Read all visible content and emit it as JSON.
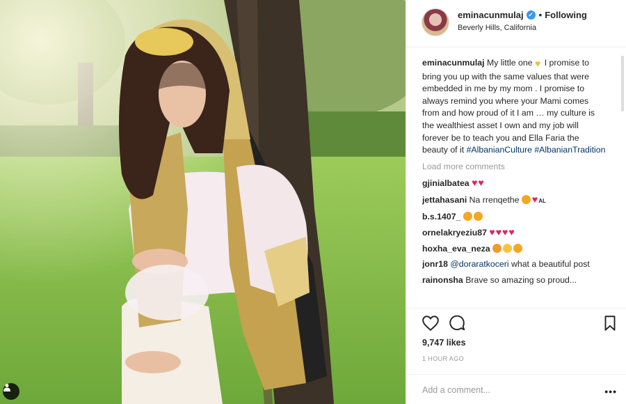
{
  "post": {
    "username": "eminacunmulaj",
    "follow_status": "Following",
    "location": "Beverly Hills, California",
    "caption_user": "eminacunmulaj",
    "caption_text_1": "My little one ",
    "caption_text_2": " I promise to bring you up with the same values that were embedded in me by my mom . I promise to always remind you where your Mami comes from and how proud of it I am … my culture is the wealthiest asset I own and my job will forever be to teach you and Ella Faria the beauty of it ",
    "hashtag_1": "#AlbanianCulture",
    "hashtag_2": "#AlbanianTradition",
    "load_more": "Load more comments",
    "likes": "9,747 likes",
    "time_ago": "1 HOUR AGO",
    "add_comment_placeholder": "Add a comment...",
    "more_label": "•••"
  },
  "comments": [
    {
      "user": "gjinialbatea",
      "text": "",
      "emojis": [
        "heart",
        "heart"
      ]
    },
    {
      "user": "jettahasani",
      "text": "Na rrenqethe",
      "emojis": [
        "heart-eyes",
        "heart"
      ],
      "suffix": "AL"
    },
    {
      "user": "b.s.1407_",
      "text": "",
      "emojis": [
        "heart-eyes",
        "heart-eyes"
      ]
    },
    {
      "user": "ornelakryeziu87",
      "text": "",
      "emojis": [
        "heart",
        "heart",
        "heart",
        "heart"
      ]
    },
    {
      "user": "hoxha_eva_neza",
      "text": "",
      "emojis": [
        "cat-heart-eyes",
        "smile",
        "heart-eyes"
      ]
    },
    {
      "user": "jonr18",
      "mention": "@doraratkoceri",
      "text": "what a beautiful post"
    },
    {
      "user": "rainonsha",
      "text": "Brave so amazing so proud..."
    }
  ],
  "colors": {
    "accent_blue": "#3897f0",
    "link": "#003569",
    "heart": "#e0245e"
  }
}
